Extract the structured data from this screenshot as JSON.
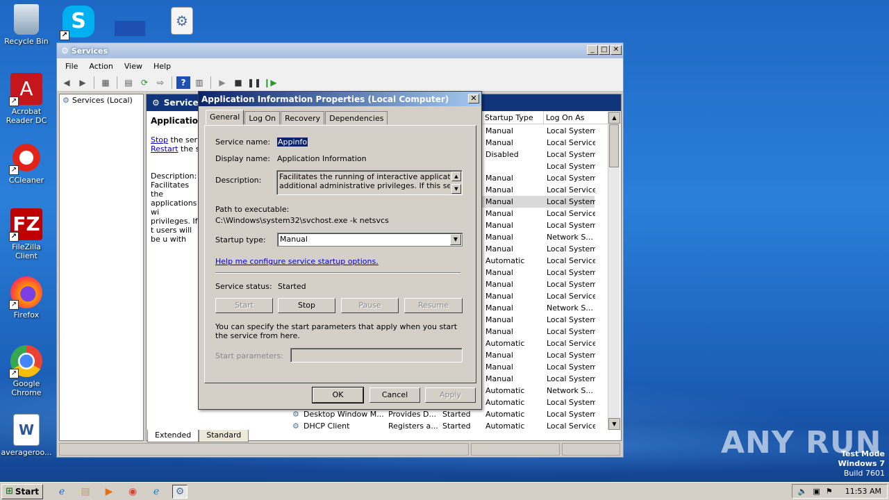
{
  "desktop": {
    "icons": [
      {
        "label": "Recycle Bin",
        "icon": "recycle-bin-icon"
      },
      {
        "label": "Acrobat Reader DC",
        "icon": "acrobat-icon"
      },
      {
        "label": "CCleaner",
        "icon": "ccleaner-icon"
      },
      {
        "label": "FileZilla Client",
        "icon": "filezilla-icon"
      },
      {
        "label": "Firefox",
        "icon": "firefox-icon"
      },
      {
        "label": "Google Chrome",
        "icon": "chrome-icon"
      },
      {
        "label": "averageroo...",
        "icon": "word-document-icon"
      }
    ],
    "watermark": "ANY RUN",
    "test_mode": {
      "line1": "Test Mode",
      "line2": "Windows 7",
      "line3": "Build 7601"
    }
  },
  "services_window": {
    "title": "Services",
    "menu": [
      "File",
      "Action",
      "View",
      "Help"
    ],
    "tree_root": "Services (Local)",
    "banner": "Services",
    "selected_service_title": "Application I",
    "stop_link": "Stop",
    "stop_text": " the servic",
    "restart_link": "Restart",
    "restart_text": " the se",
    "description_label": "Description:",
    "description_text": "Facilitates the applications wi privileges. If t users will be u with the additi privileges they desired user ta",
    "columns": {
      "startup_type": "Startup Type",
      "log_on_as": "Log On As"
    },
    "rows": [
      {
        "name": "",
        "desc": "",
        "status": "",
        "startup": "Manual",
        "logon": "Local System"
      },
      {
        "name": "",
        "desc": "",
        "status": "",
        "startup": "Manual",
        "logon": "Local Service"
      },
      {
        "name": "",
        "desc": "",
        "status": "",
        "startup": "Disabled",
        "logon": "Local System"
      },
      {
        "name": "",
        "desc": "",
        "status": "",
        "startup": "",
        "logon": "Local System"
      },
      {
        "name": "",
        "desc": "",
        "status": "",
        "startup": "Manual",
        "logon": "Local System"
      },
      {
        "name": "",
        "desc": "",
        "status": "",
        "startup": "Manual",
        "logon": "Local Service"
      },
      {
        "name": "",
        "desc": "",
        "status": "",
        "startup": "Manual",
        "logon": "Local System"
      },
      {
        "name": "",
        "desc": "",
        "status": "",
        "startup": "Manual",
        "logon": "Local Service"
      },
      {
        "name": "",
        "desc": "",
        "status": "",
        "startup": "Manual",
        "logon": "Local System"
      },
      {
        "name": "",
        "desc": "",
        "status": "",
        "startup": "Manual",
        "logon": "Network S..."
      },
      {
        "name": "",
        "desc": "",
        "status": "",
        "startup": "Manual",
        "logon": "Local System"
      },
      {
        "name": "",
        "desc": "",
        "status": "",
        "startup": "Automatic",
        "logon": "Local Service"
      },
      {
        "name": "",
        "desc": "",
        "status": "",
        "startup": "Manual",
        "logon": "Local System"
      },
      {
        "name": "",
        "desc": "",
        "status": "",
        "startup": "Manual",
        "logon": "Local System"
      },
      {
        "name": "",
        "desc": "",
        "status": "",
        "startup": "Manual",
        "logon": "Local Service"
      },
      {
        "name": "",
        "desc": "",
        "status": "",
        "startup": "Manual",
        "logon": "Network S..."
      },
      {
        "name": "",
        "desc": "",
        "status": "",
        "startup": "Manual",
        "logon": "Local System"
      },
      {
        "name": "",
        "desc": "",
        "status": "",
        "startup": "Manual",
        "logon": "Local System"
      },
      {
        "name": "",
        "desc": "",
        "status": "",
        "startup": "Automatic",
        "logon": "Local Service"
      },
      {
        "name": "",
        "desc": "",
        "status": "",
        "startup": "Manual",
        "logon": "Local System"
      },
      {
        "name": "",
        "desc": "",
        "status": "",
        "startup": "Manual",
        "logon": "Local System"
      },
      {
        "name": "",
        "desc": "",
        "status": "",
        "startup": "Manual",
        "logon": "Local System"
      },
      {
        "name": "",
        "desc": "",
        "status": "",
        "startup": "Automatic",
        "logon": "Network S..."
      },
      {
        "name": "",
        "desc": "",
        "status": "",
        "startup": "Automatic",
        "logon": "Local System"
      },
      {
        "name": "Desktop Window M...",
        "desc": "Provides D...",
        "status": "Started",
        "startup": "Automatic",
        "logon": "Local System"
      },
      {
        "name": "DHCP Client",
        "desc": "Registers a...",
        "status": "Started",
        "startup": "Automatic",
        "logon": "Local Service"
      }
    ],
    "selected_row_index": 6,
    "bottom_tabs": [
      "Extended",
      "Standard"
    ]
  },
  "dialog": {
    "title": "Application Information Properties (Local Computer)",
    "tabs": [
      "General",
      "Log On",
      "Recovery",
      "Dependencies"
    ],
    "active_tab": "General",
    "service_name_label": "Service name:",
    "service_name": "Appinfo",
    "display_name_label": "Display name:",
    "display_name": "Application Information",
    "description_label": "Description:",
    "description_line1": "Facilitates the running of interactive applications with",
    "description_line2": "additional administrative privileges.  If this service is",
    "path_label": "Path to executable:",
    "path": "C:\\Windows\\system32\\svchost.exe -k netsvcs",
    "startup_type_label": "Startup type:",
    "startup_type": "Manual",
    "help_link": "Help me configure service startup options.",
    "service_status_label": "Service status:",
    "service_status": "Started",
    "buttons": {
      "start": "Start",
      "stop": "Stop",
      "pause": "Pause",
      "resume": "Resume"
    },
    "params_note": "You can specify the start parameters that apply when you start the service from here.",
    "start_params_label": "Start parameters:",
    "ok": "OK",
    "cancel": "Cancel",
    "apply": "Apply"
  },
  "taskbar": {
    "start_label": "Start",
    "clock": "11:53 AM",
    "apps": [
      "internet-explorer-icon",
      "file-explorer-icon",
      "media-player-icon",
      "chrome-icon",
      "edge-icon",
      "services-icon"
    ]
  }
}
